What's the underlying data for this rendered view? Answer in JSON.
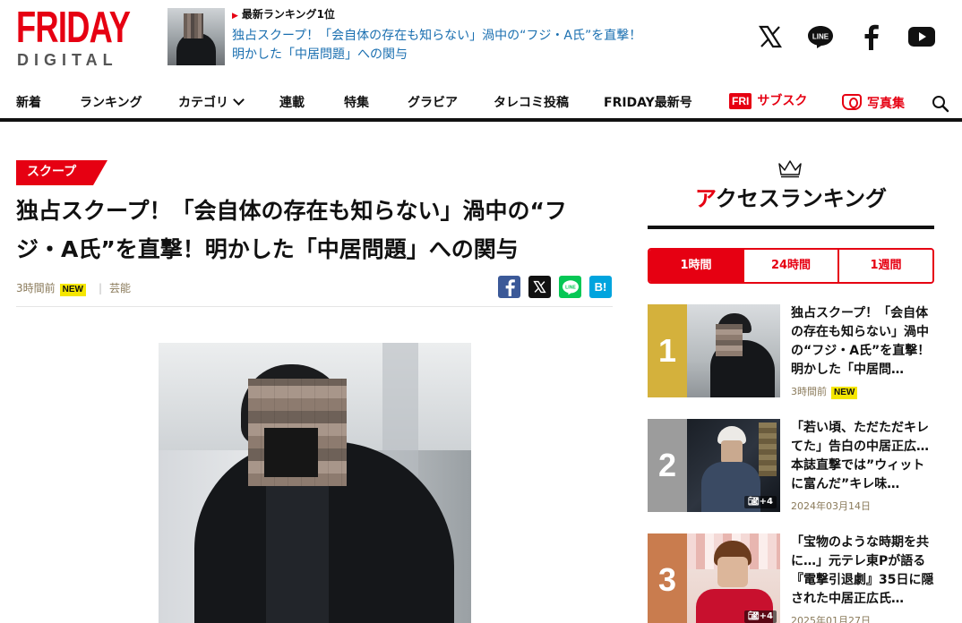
{
  "brand": {
    "name": "FRIDAY",
    "sub": "DIGITAL",
    "color": "#e60012"
  },
  "top_ranking": {
    "label": "最新ランキング1位",
    "title": "独占スクープ！「会自体の存在も知らない」渦中の“フジ・A氏”を直撃！明かした「中居問題」への関与"
  },
  "social": [
    "x-icon",
    "line-icon",
    "facebook-icon",
    "youtube-icon"
  ],
  "nav": {
    "items": [
      "新着",
      "ランキング",
      "カテゴリ",
      "連載",
      "特集",
      "グラビア",
      "タレコミ投稿",
      "FRIDAY最新号"
    ],
    "subscribe_badge": "FRI",
    "subscribe": "サブスク",
    "photobook": "写真集"
  },
  "article": {
    "category": "スクープ",
    "title": "独占スクープ！「会自体の存在も知らない」渦中の“フジ・A氏”を直撃！明かした「中居問題」への関与",
    "time": "3時間前",
    "new_badge": "NEW",
    "genre": "芸能",
    "share_colors": {
      "facebook": "#3b5998",
      "x": "#111111",
      "line": "#06c755",
      "hatena": "#00a4de"
    },
    "hatena_label": "B!"
  },
  "sidebar": {
    "ranking_title_accent": "ア",
    "ranking_title_rest": "クセスランキング",
    "tabs": [
      "1時間",
      "24時間",
      "1週間"
    ],
    "items": [
      {
        "rank": "1",
        "title": "独占スクープ！「会自体の存在も知らない」渦中の“フジ・A氏”を直撃！明かした「中居問…",
        "date": "3時間前",
        "new": "NEW",
        "photos": "",
        "color": "#d4b13c"
      },
      {
        "rank": "2",
        "title": "「若い頃、ただただキレてた」告白の中居正広…本誌直撃では”ウィットに富んだ”キレ味…",
        "date": "2024年03月14日",
        "new": "",
        "photos": "+4",
        "color": "#9c9c9c"
      },
      {
        "rank": "3",
        "title": "「宝物のような時期を共に…」元テレ東Pが語る『電撃引退劇』35日に隠された中居正広氏…",
        "date": "2025年01月27日",
        "new": "",
        "photos": "+4",
        "color": "#c97c4e"
      }
    ]
  }
}
